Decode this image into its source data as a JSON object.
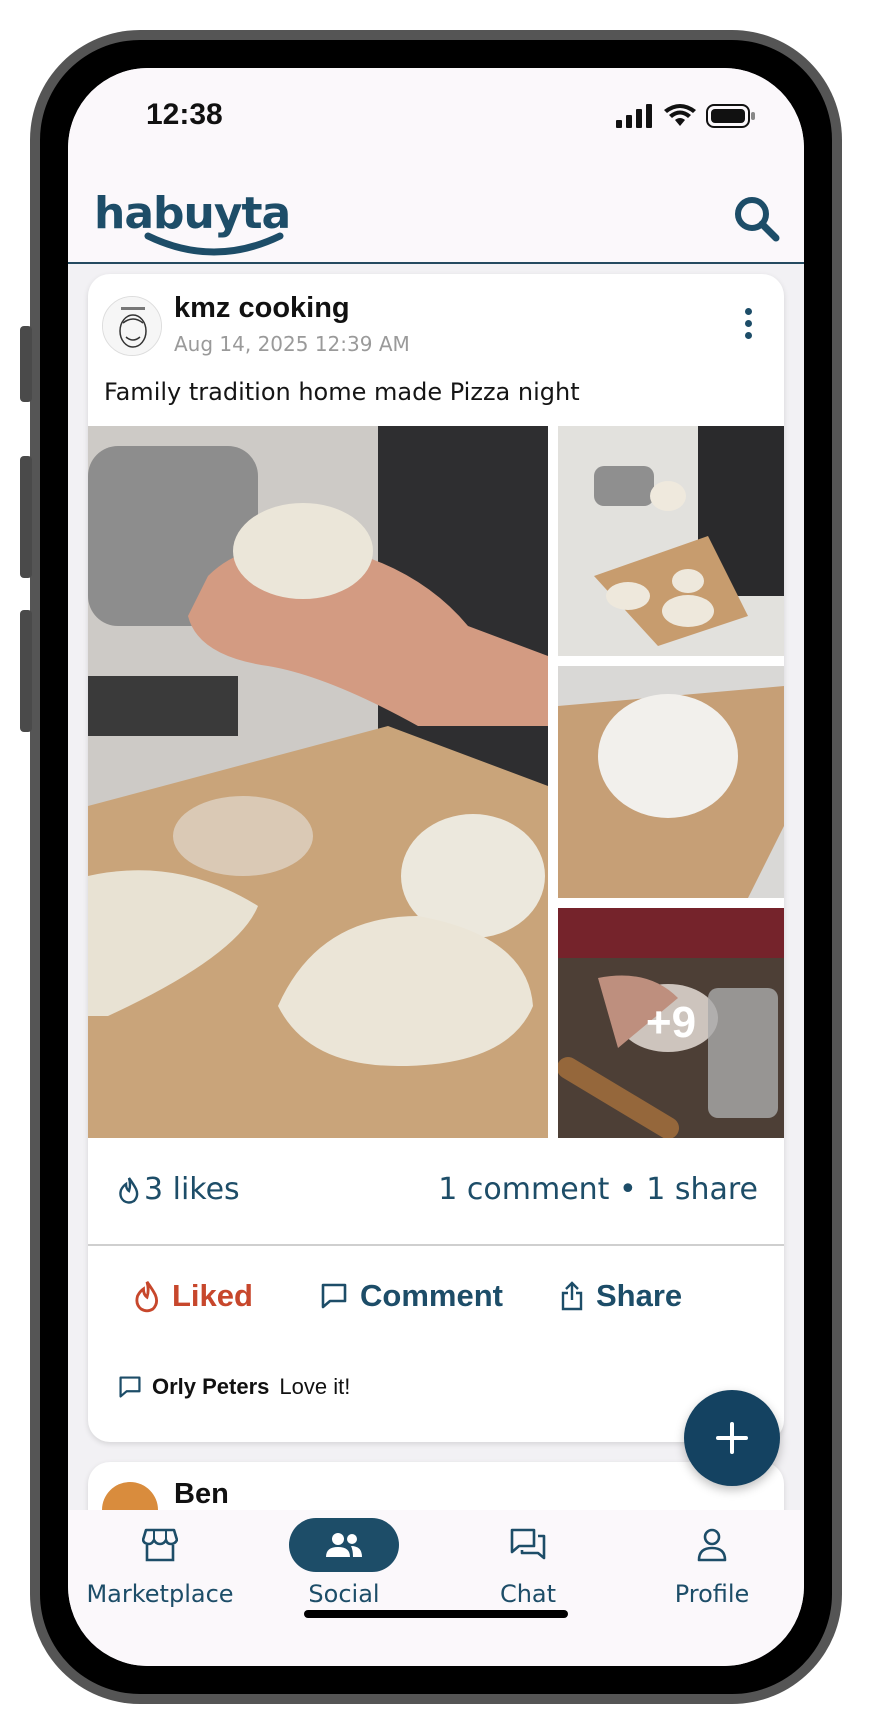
{
  "status_bar": {
    "time": "12:38",
    "icons": [
      "signal-icon",
      "wifi-icon",
      "battery-icon"
    ]
  },
  "header": {
    "logo_text": "habuyta",
    "search_icon": "search-icon"
  },
  "post": {
    "author": "kmz cooking",
    "date": "Aug 14, 2025 12:39 AM",
    "text": "Family tradition home made Pizza night",
    "photos_more": "+9",
    "likes_label": "3 likes",
    "engagement_label": "1 comment • 1 share",
    "actions": {
      "like_label": "Liked",
      "comment_label": "Comment",
      "share_label": "Share"
    },
    "comment_preview": {
      "author": "Orly Peters",
      "text": "Love it!"
    }
  },
  "next_post": {
    "author": "Ben"
  },
  "bottom_nav": {
    "items": [
      {
        "label": "Marketplace",
        "icon": "store-icon",
        "active": false
      },
      {
        "label": "Social",
        "icon": "people-icon",
        "active": true
      },
      {
        "label": "Chat",
        "icon": "chat-icon",
        "active": false
      },
      {
        "label": "Profile",
        "icon": "person-icon",
        "active": false
      }
    ]
  },
  "colors": {
    "brand": "#1d4d68",
    "liked": "#c7472c",
    "fab": "#144261",
    "screen_bg": "#f2f1f4"
  }
}
